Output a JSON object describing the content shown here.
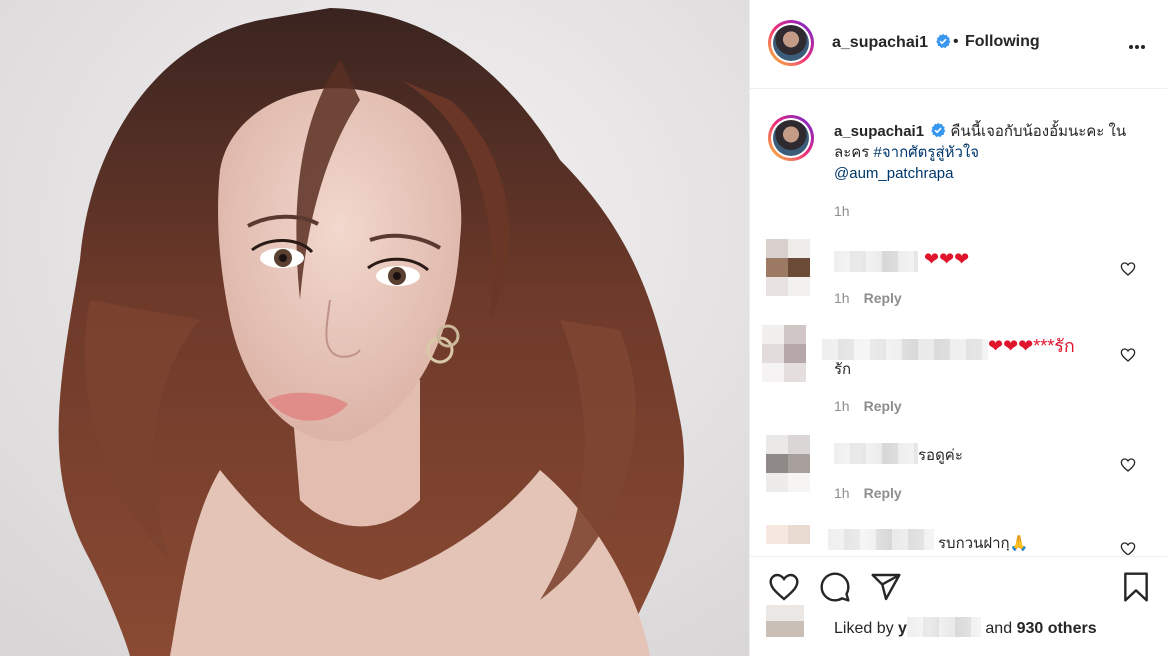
{
  "post": {
    "username": "a_supachai1",
    "follow_status": "Following",
    "separator": "•"
  },
  "caption": {
    "username": "a_supachai1",
    "text": "คืนนี้เจอกับน้องอั้มนะคะ ในละคร",
    "hashtag": "#จากศัตรูสู่หัวใจ",
    "mention": "@aum_patchrapa",
    "time": "1h"
  },
  "comments": [
    {
      "text": "❤❤❤",
      "time": "1h",
      "reply_label": "Reply"
    },
    {
      "text": "❤❤❤***รัก",
      "text2": "รัก",
      "time": "1h",
      "reply_label": "Reply"
    },
    {
      "text": "รอดูค่ะ",
      "time": "1h",
      "reply_label": "Reply"
    },
    {
      "text": "รบกวนฝากฺ🙏"
    }
  ],
  "likes": {
    "prefix": "Liked by",
    "partial_name": "y",
    "suffix": "and",
    "count": "930 others"
  },
  "icons": [
    "verified-badge-icon",
    "more-options-icon",
    "heart-icon",
    "comment-icon",
    "share-icon",
    "bookmark-icon"
  ],
  "colors": {
    "link": "#00376b",
    "muted": "#8e8e8e",
    "verified": "#3897f0",
    "heart": "#e0142a"
  }
}
